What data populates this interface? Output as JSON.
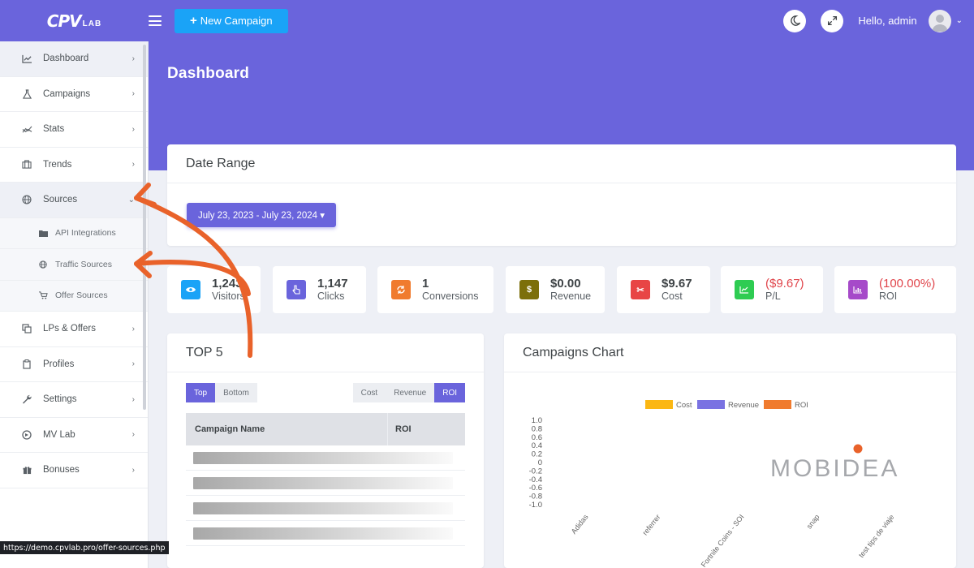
{
  "topbar": {
    "logo_main": "CPV",
    "logo_sub": "LAB",
    "new_campaign_label": "New Campaign",
    "greeting": "Hello, admin"
  },
  "sidebar": {
    "items": [
      {
        "label": "Dashboard",
        "icon": "chart-line-icon"
      },
      {
        "label": "Campaigns",
        "icon": "flask-icon"
      },
      {
        "label": "Stats",
        "icon": "stats-icon"
      },
      {
        "label": "Trends",
        "icon": "briefcase-icon"
      },
      {
        "label": "Sources",
        "icon": "globe-icon"
      },
      {
        "label": "LPs & Offers",
        "icon": "layers-icon"
      },
      {
        "label": "Profiles",
        "icon": "clipboard-icon"
      },
      {
        "label": "Settings",
        "icon": "wrench-icon"
      },
      {
        "label": "MV Lab",
        "icon": "mv-lab-icon"
      },
      {
        "label": "Bonuses",
        "icon": "gift-icon"
      }
    ],
    "sources_sub": [
      {
        "label": "API Integrations",
        "icon": "folder-icon"
      },
      {
        "label": "Traffic Sources",
        "icon": "globe-icon"
      },
      {
        "label": "Offer Sources",
        "icon": "cart-icon"
      }
    ]
  },
  "page": {
    "title": "Dashboard"
  },
  "date_range": {
    "title": "Date Range",
    "value": "July 23, 2023 - July 23, 2024 ▾"
  },
  "stats": [
    {
      "value": "1,243",
      "label": "Visitors",
      "color": "#1aa3f7",
      "icon": "eye-icon"
    },
    {
      "value": "1,147",
      "label": "Clicks",
      "color": "#6a64dc",
      "icon": "pointer-icon"
    },
    {
      "value": "1",
      "label": "Conversions",
      "color": "#f07b2e",
      "icon": "refresh-icon"
    },
    {
      "value": "$0.00",
      "label": "Revenue",
      "color": "#7c6f0a",
      "icon": "dollar-icon"
    },
    {
      "value": "$9.67",
      "label": "Cost",
      "color": "#e84545",
      "icon": "scissors-icon"
    },
    {
      "value": "($9.67)",
      "label": "P/L",
      "color": "#2ecc52",
      "icon": "trend-icon"
    },
    {
      "value": "(100.00%)",
      "label": "ROI",
      "color": "#a64ac9",
      "icon": "bar-chart-icon"
    }
  ],
  "top5": {
    "title": "TOP 5",
    "seg_left": [
      "Top",
      "Bottom"
    ],
    "seg_right": [
      "Cost",
      "Revenue",
      "ROI"
    ],
    "col_campaign": "Campaign Name",
    "col_roi": "ROI"
  },
  "chart_data": {
    "type": "line",
    "title": "Campaigns Chart",
    "categories": [
      "Adidas",
      "referrer",
      "Fortnite Coins - SOI",
      "snap",
      "test tips de viaje"
    ],
    "series": [
      {
        "name": "Cost",
        "color": "#fbb714",
        "values": []
      },
      {
        "name": "Revenue",
        "color": "#7a72e2",
        "values": []
      },
      {
        "name": "ROI",
        "color": "#f07b2e",
        "values": []
      }
    ],
    "yticks": [
      "1.0",
      "0.8",
      "0.6",
      "0.4",
      "0.2",
      "0",
      "-0.2",
      "-0.4",
      "-0.6",
      "-0.8",
      "-1.0"
    ],
    "ylim": [
      -1.0,
      1.0
    ],
    "legend": "top"
  },
  "watermark": "MOBIDEA",
  "status_url": "https://demo.cpvlab.pro/offer-sources.php"
}
